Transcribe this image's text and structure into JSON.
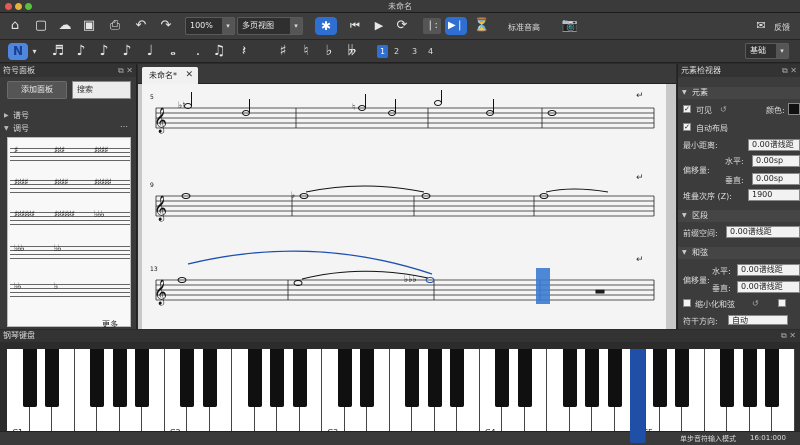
{
  "window": {
    "title": "未命名"
  },
  "toolbar": {
    "zoom_value": "100%",
    "view_mode": "多页视图",
    "concert_pitch_label": "标准音高",
    "feedback_label": "反馈",
    "workspace_value": "基础"
  },
  "note_input": {
    "mode_label": "N",
    "voices": [
      "1",
      "2",
      "3",
      "4"
    ]
  },
  "palette": {
    "title": "符号面板",
    "add_palette_label": "添加面板",
    "search_label": "搜索",
    "sections": [
      "谱号",
      "调号"
    ],
    "more_label": "更多",
    "key_signatures": [
      "♯",
      "♯♯♯",
      "♯♯♯♯",
      "♯♯♯♯",
      "♯♯♯♯",
      "♯♯♯♯♯",
      "♯♯♯♯♯♯",
      "♯♯♯♯♯♯",
      "♭♭♭",
      "♭♭♭",
      "♭♭",
      "",
      "♭♭",
      "♭",
      ""
    ]
  },
  "score": {
    "tab_label": "未命名*",
    "measure_numbers": [
      "5",
      "9",
      "13"
    ]
  },
  "inspector": {
    "title": "元素检视器",
    "section_element": "元素",
    "visible_label": "可见",
    "color_label": "颜色:",
    "auto_place_label": "自动布局",
    "min_distance_label": "最小距离:",
    "min_distance_value": "0.00谱线距",
    "offset_label": "偏移量:",
    "horizontal_label": "水平:",
    "horizontal_value": "0.00sp",
    "vertical_label": "垂直:",
    "vertical_value": "0.00sp",
    "stacking_label": "堆叠次序 (Z):",
    "stacking_value": "1900",
    "section_segment": "区段",
    "leading_space_label": "前缀空间:",
    "leading_space_value": "0.00谱线距",
    "section_slur": "和弦",
    "slur_horizontal_label": "水平:",
    "slur_horizontal_value": "0.00谱线距",
    "slur_offset_label": "偏移量:",
    "slur_vertical_label": "垂直:",
    "slur_vertical_value": "0.00谱线距",
    "small_chord_label": "缩小化和弦",
    "stem_direction_label": "符干方向:",
    "stem_direction_value": "自动"
  },
  "piano": {
    "title": "钢琴键盘",
    "octave_labels": [
      "C1",
      "C2",
      "C3",
      "C4",
      "C5",
      "C6"
    ]
  },
  "status": {
    "mode_text": "单步音符输入模式",
    "position_text": "16:01:000"
  }
}
